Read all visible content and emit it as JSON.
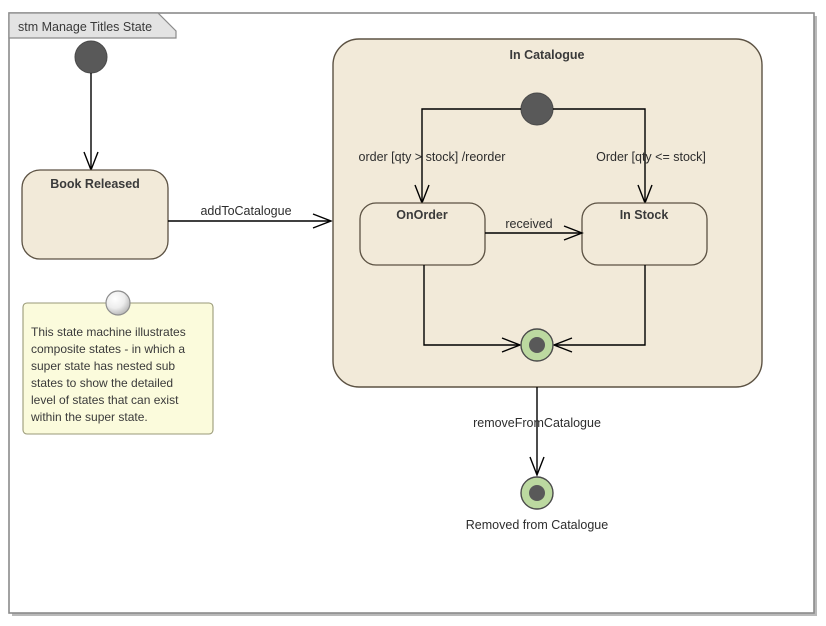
{
  "frame": {
    "title": "stm Manage Titles State"
  },
  "states": {
    "book_released": "Book Released",
    "in_catalogue": "In Catalogue",
    "on_order": "OnOrder",
    "in_stock": "In Stock"
  },
  "transitions": {
    "add_to_catalogue": "addToCatalogue",
    "order_reorder": "order [qty > stock] /reorder",
    "order_in_stock": "Order [qty <= stock]",
    "received": "received",
    "remove_from_catalogue": "removeFromCatalogue"
  },
  "nodes": {
    "removed_from_catalogue_caption": "Removed from Catalogue"
  },
  "note": {
    "lines": [
      "This state machine illustrates",
      "composite states - in which a",
      "super state has nested  sub",
      "states to show the detailed",
      "level of states that can exist",
      "within the super state."
    ]
  },
  "colors": {
    "state_fill": "#f2ead9",
    "state_stroke": "#5c5243",
    "final_ring": "#bcd9a0",
    "final_dot": "#595959",
    "note_fill": "#fbfbdc",
    "frame_stroke": "#8b8b8b",
    "tab_fill": "#e3e3e3"
  }
}
